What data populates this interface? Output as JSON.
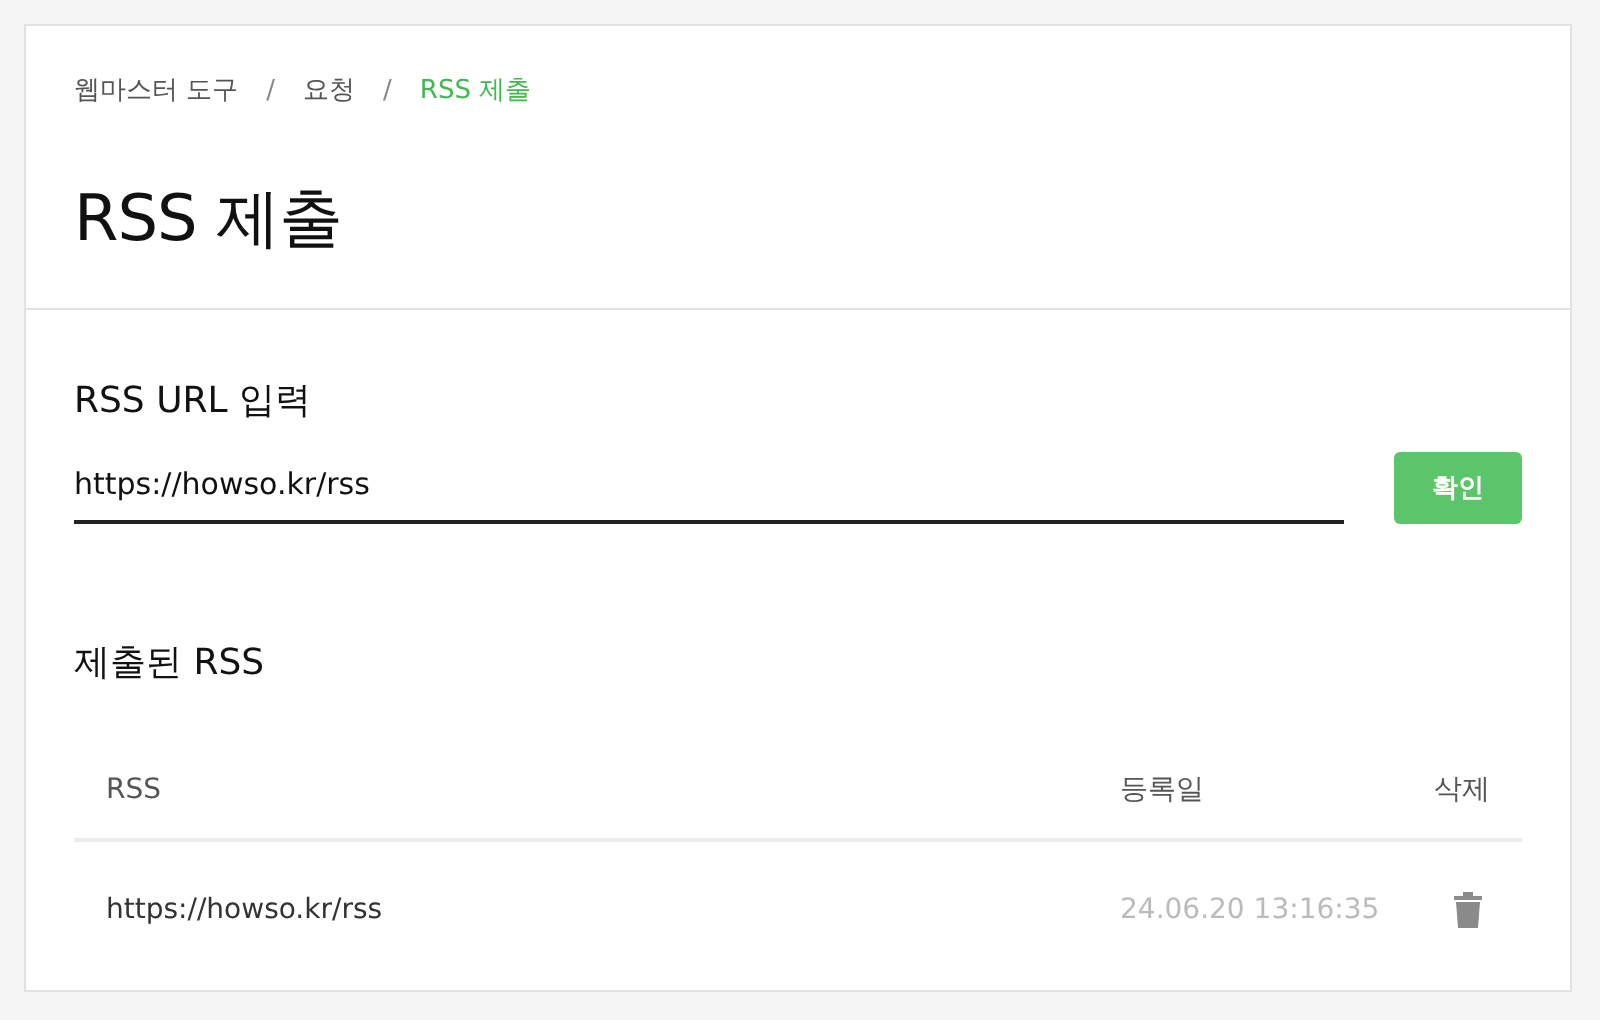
{
  "breadcrumb_separator": "/",
  "breadcrumb": [
    {
      "label": "웹마스터 도구",
      "current": false
    },
    {
      "label": "요청",
      "current": false
    },
    {
      "label": "RSS 제출",
      "current": true
    }
  ],
  "title": "RSS 제출",
  "url_form": {
    "label": "RSS URL 입력",
    "value": "https://howso.kr/rss",
    "button": "확인"
  },
  "submitted": {
    "heading": "제출된 RSS",
    "columns": [
      "RSS",
      "등록일",
      "삭제"
    ],
    "rows": [
      {
        "rss": "https://howso.kr/rss",
        "date": "24.06.20 13:16:35"
      }
    ]
  }
}
